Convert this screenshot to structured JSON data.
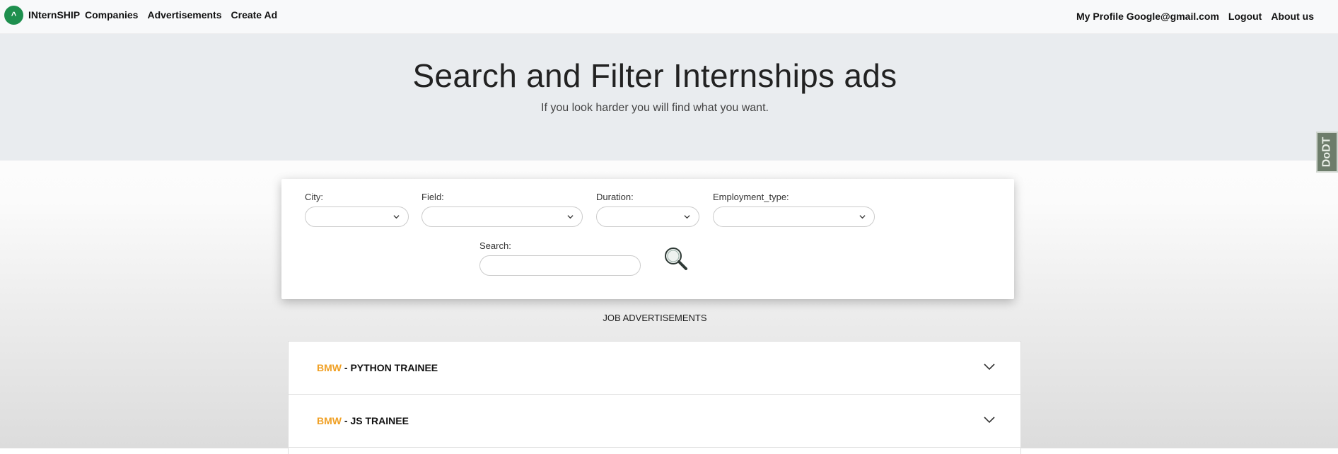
{
  "navbar": {
    "logo_glyph": "^",
    "brand": "INternSHIP",
    "links": [
      "Companies",
      "Advertisements",
      "Create Ad"
    ],
    "profile": "My Profile Google@gmail.com",
    "logout": "Logout",
    "about": "About us"
  },
  "hero": {
    "title": "Search and Filter Internships ads",
    "subtitle": "If you look harder you will find what you want."
  },
  "side_tab": {
    "label": "DoDT"
  },
  "filters": {
    "city_label": "City:",
    "field_label": "Field:",
    "duration_label": "Duration:",
    "employment_label": "Employment_type:",
    "search_label": "Search:",
    "city_value": "",
    "field_value": "",
    "duration_value": "",
    "employment_value": "",
    "search_value": ""
  },
  "ads": {
    "heading": "JOB ADVERTISEMENTS",
    "items": [
      {
        "company": "BMW",
        "separator": " - ",
        "position": "PYTHON TRAINEE"
      },
      {
        "company": "BMW",
        "separator": " - ",
        "position": "JS TRAINEE"
      }
    ]
  },
  "colors": {
    "accent_green": "#1e8f4e",
    "company_orange": "#f0a024",
    "hero_bg": "#e9ecef"
  },
  "icons": [
    "logo-icon",
    "chevron-down-icon",
    "search-icon"
  ]
}
